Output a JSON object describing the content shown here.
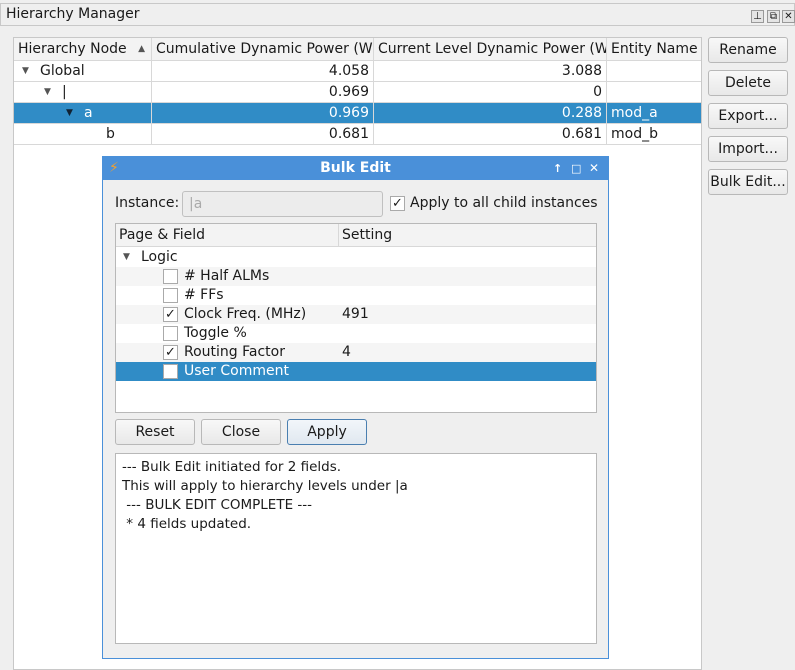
{
  "panel": {
    "title": "Hierarchy Manager"
  },
  "table": {
    "columns": [
      "Hierarchy Node",
      "Cumulative Dynamic Power (W)",
      "Current Level Dynamic Power (W)",
      "Entity Name"
    ],
    "rows": [
      {
        "node": "Global",
        "cumulative": "4.058",
        "current": "3.088",
        "entity": ""
      },
      {
        "node": "|",
        "cumulative": "0.969",
        "current": "0",
        "entity": ""
      },
      {
        "node": "a",
        "cumulative": "0.969",
        "current": "0.288",
        "entity": "mod_a"
      },
      {
        "node": "b",
        "cumulative": "0.681",
        "current": "0.681",
        "entity": "mod_b"
      }
    ]
  },
  "buttons": {
    "rename": "Rename",
    "delete": "Delete",
    "export": "Export...",
    "import": "Import...",
    "bulk_edit": "Bulk Edit..."
  },
  "dialog": {
    "title": "Bulk Edit",
    "instance_label": "Instance:",
    "instance_value": "|a",
    "apply_all_label": "Apply to all child instances",
    "apply_all_checked": true,
    "columns": [
      "Page & Field",
      "Setting"
    ],
    "group": "Logic",
    "fields": [
      {
        "label": "# Half ALMs",
        "checked": false,
        "setting": ""
      },
      {
        "label": "# FFs",
        "checked": false,
        "setting": ""
      },
      {
        "label": "Clock Freq. (MHz)",
        "checked": true,
        "setting": "491"
      },
      {
        "label": "Toggle %",
        "checked": false,
        "setting": ""
      },
      {
        "label": "Routing Factor",
        "checked": true,
        "setting": "4"
      },
      {
        "label": "User Comment",
        "checked": false,
        "setting": ""
      }
    ],
    "reset": "Reset",
    "close": "Close",
    "apply": "Apply",
    "log": [
      "--- Bulk Edit initiated for 2 fields.",
      "This will apply to hierarchy levels under |a",
      " --- BULK EDIT COMPLETE ---",
      " * 4 fields updated."
    ]
  },
  "colors": {
    "selection": "#308cc6",
    "dialog_title": "#4a90d9"
  }
}
